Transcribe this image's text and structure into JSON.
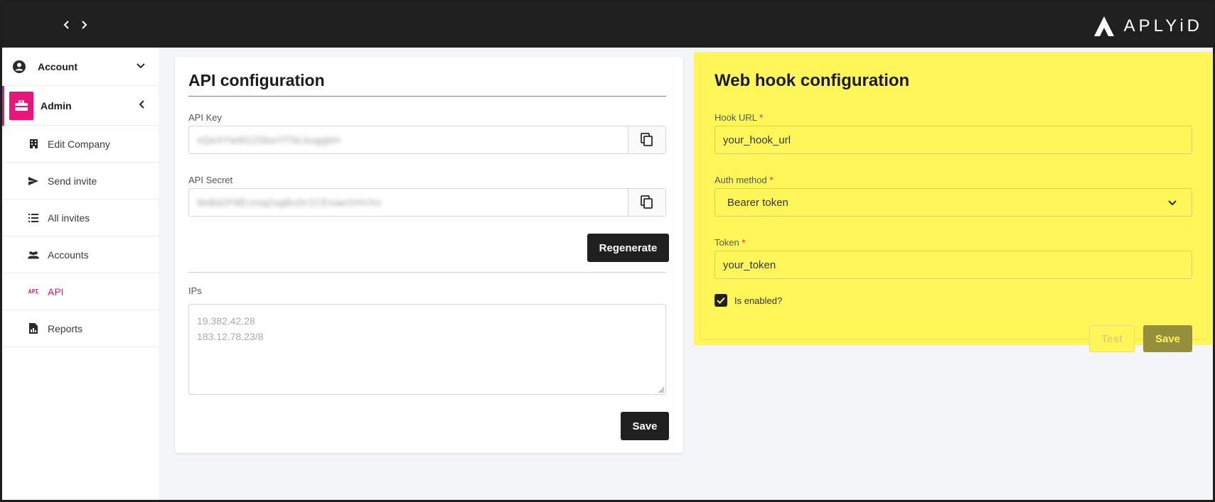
{
  "brand": {
    "name": "APLYiD"
  },
  "sidebar": {
    "account_label": "Account",
    "admin_label": "Admin",
    "items": [
      {
        "label": "Edit Company",
        "icon": "building-icon"
      },
      {
        "label": "Send invite",
        "icon": "send-icon"
      },
      {
        "label": "All invites",
        "icon": "list-icon"
      },
      {
        "label": "Accounts",
        "icon": "people-icon"
      },
      {
        "label": "API",
        "icon": "api-icon",
        "badge": "API",
        "active": true
      },
      {
        "label": "Reports",
        "icon": "report-icon"
      }
    ]
  },
  "api_config": {
    "title": "API configuration",
    "api_key_label": "API Key",
    "api_key_value": "xQe4Yte8G2SkaYf7bLkuggbH",
    "api_secret_label": "API Secret",
    "api_secret_value": "9eBd2F8Erznq2xgBcDr1CEnaeGHVXx",
    "regenerate_label": "Regenerate",
    "ips_label": "IPs",
    "ips_placeholder_line1": "19.382.42.28",
    "ips_placeholder_line2": "183.12.78.23/8",
    "save_label": "Save"
  },
  "webhook_config": {
    "title": "Web hook configuration",
    "hook_url_label": "Hook URL",
    "hook_url_value": "your_hook_url",
    "auth_method_label": "Auth method",
    "auth_method_value": "Bearer token",
    "token_label": "Token",
    "token_value": "your_token",
    "required_mark": "*",
    "enabled_label": "Is enabled?",
    "enabled": true,
    "test_label": "Test",
    "save_label": "Save"
  },
  "colors": {
    "accent": "#e8157a",
    "topbar": "#1f201f",
    "highlight": "#fff758",
    "olive_button": "#958e3b"
  }
}
